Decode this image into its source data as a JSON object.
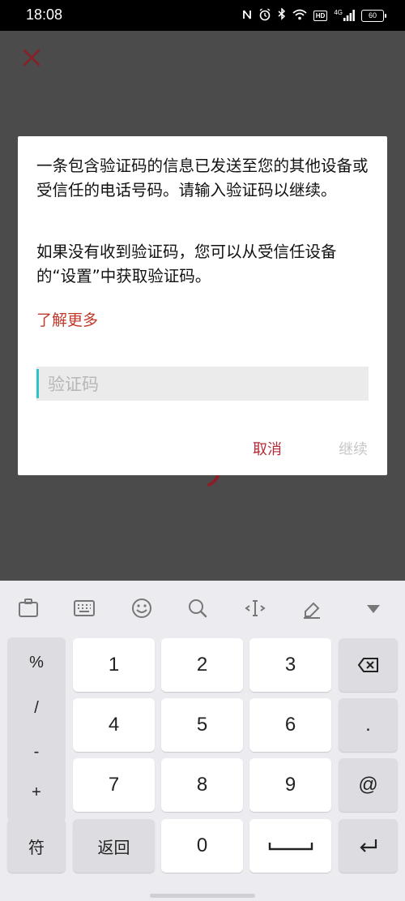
{
  "status_bar": {
    "time": "18:08",
    "icons": [
      "nfc-icon",
      "alarm-icon",
      "bluetooth-icon",
      "wifi-icon",
      "hd-icon",
      "signal-icon",
      "battery-icon"
    ],
    "hd_label": "HD",
    "signal_label": "4G",
    "battery_level": "60"
  },
  "dialog": {
    "message_1": "一条包含验证码的信息已发送至您的其他设备或受信任的电话号码。请输入验证码以继续。",
    "message_2": "如果没有收到验证码，您可以从受信任设备的“设置”中获取验证码。",
    "learn_more": "了解更多",
    "input_placeholder": "验证码",
    "cancel": "取消",
    "continue": "继续"
  },
  "keyboard": {
    "toolbar_icons": [
      "clipboard-icon",
      "keyboard-layout-icon",
      "emoji-icon",
      "search-icon",
      "cursor-move-icon",
      "edit-icon",
      "hide-keyboard-icon"
    ],
    "symbols": [
      "%",
      "/",
      "-",
      "+"
    ],
    "digits": [
      "1",
      "2",
      "3",
      "4",
      "5",
      "6",
      "7",
      "8",
      "9",
      "0"
    ],
    "dot": ".",
    "at": "@",
    "fu": "符",
    "back": "返回",
    "space_icon": "space-icon",
    "enter_icon": "enter-icon",
    "backspace_icon": "backspace-icon"
  },
  "colors": {
    "accent_red": "#b42a36",
    "cursor": "#2ec4c9"
  }
}
